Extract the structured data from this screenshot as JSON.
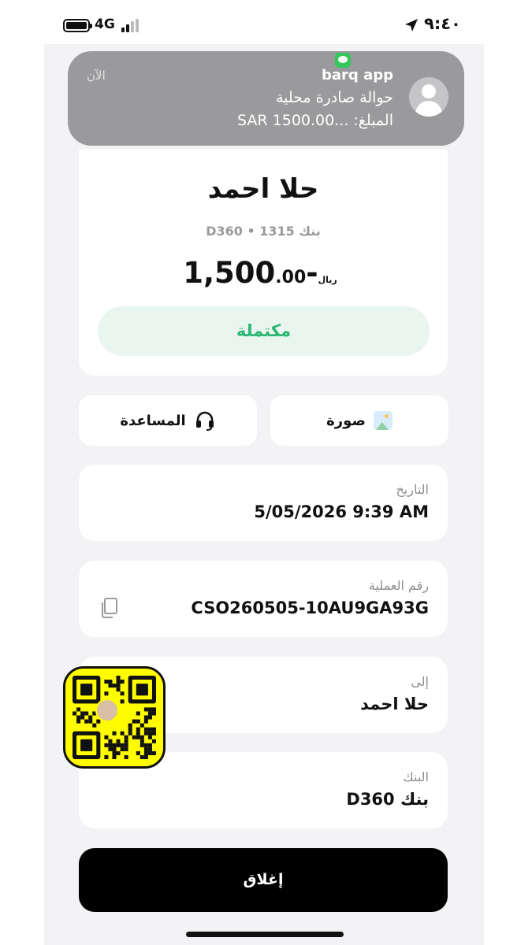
{
  "status_bar": {
    "network": "4G",
    "time": "٩:٤٠"
  },
  "notification": {
    "app": "barq app",
    "line1": "حوالة صادرة محلية",
    "line2_label": "المبلغ:",
    "line2_value": "SAR 1500.00...",
    "time": "الآن"
  },
  "transaction": {
    "recipient_name": "حلا احمد",
    "bank_line": "بنك D360 • 1315",
    "amount_main": "-1,500",
    "amount_decimal": ".00",
    "currency": "ريال",
    "status": "مكتملة",
    "status_color": "#2bb673"
  },
  "actions": {
    "photo_label": "صورة",
    "help_label": "المساعدة"
  },
  "details": {
    "date_label": "التاريخ",
    "date_value": "5/05/2026 9:39 AM",
    "ref_label": "رقم العملية",
    "ref_value": "CSO260505-10AU9GA93G",
    "to_label": "إلى",
    "to_value": "حلا احمد",
    "bank_label": "البنك",
    "bank_value": "بنك D360"
  },
  "close_label": "إغلاق"
}
